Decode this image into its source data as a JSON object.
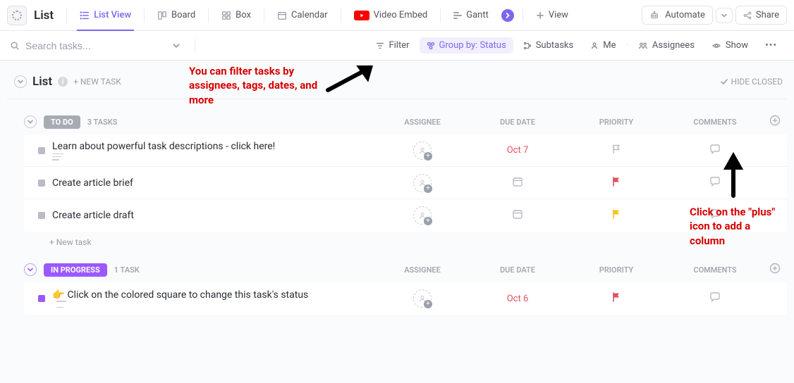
{
  "header": {
    "title": "List",
    "views": [
      {
        "label": "List View",
        "active": true
      },
      {
        "label": "Board"
      },
      {
        "label": "Box"
      },
      {
        "label": "Calendar"
      },
      {
        "label": "Video Embed"
      },
      {
        "label": "Gantt"
      }
    ],
    "add_view": "View",
    "automate": "Automate",
    "share": "Share"
  },
  "toolbar": {
    "search_placeholder": "Search tasks...",
    "filter": "Filter",
    "group_by": "Group by: Status",
    "subtasks": "Subtasks",
    "me": "Me",
    "assignees": "Assignees",
    "show": "Show"
  },
  "section": {
    "title": "List",
    "new_task": "+ NEW TASK",
    "hide_closed": "HIDE CLOSED"
  },
  "columns": [
    "ASSIGNEE",
    "DUE DATE",
    "PRIORITY",
    "COMMENTS"
  ],
  "groups": [
    {
      "name": "TO DO",
      "count": "3 TASKS",
      "pill_class": "pill-todo",
      "tasks": [
        {
          "title": "Learn about powerful task descriptions - click here!",
          "has_desc": true,
          "due": "Oct 7",
          "flag": "gray"
        },
        {
          "title": "Create article brief",
          "flag": "red",
          "due_icon": true
        },
        {
          "title": "Create article draft",
          "flag": "yellow",
          "due_icon": true
        }
      ],
      "new_task_label": "+ New task"
    },
    {
      "name": "IN PROGRESS",
      "count": "1 TASK",
      "pill_class": "pill-inprogress",
      "expand_class": "purple",
      "tasks": [
        {
          "title": "Click on the colored square to change this task's status",
          "hand": true,
          "desc_side": true,
          "due": "Oct 6",
          "flag": "red",
          "status": "purple"
        }
      ]
    }
  ],
  "annotations": {
    "filter_note": "You can filter tasks by assignees, tags, dates, and more",
    "plus_note": "Click on the \"plus\" icon to add a column"
  }
}
